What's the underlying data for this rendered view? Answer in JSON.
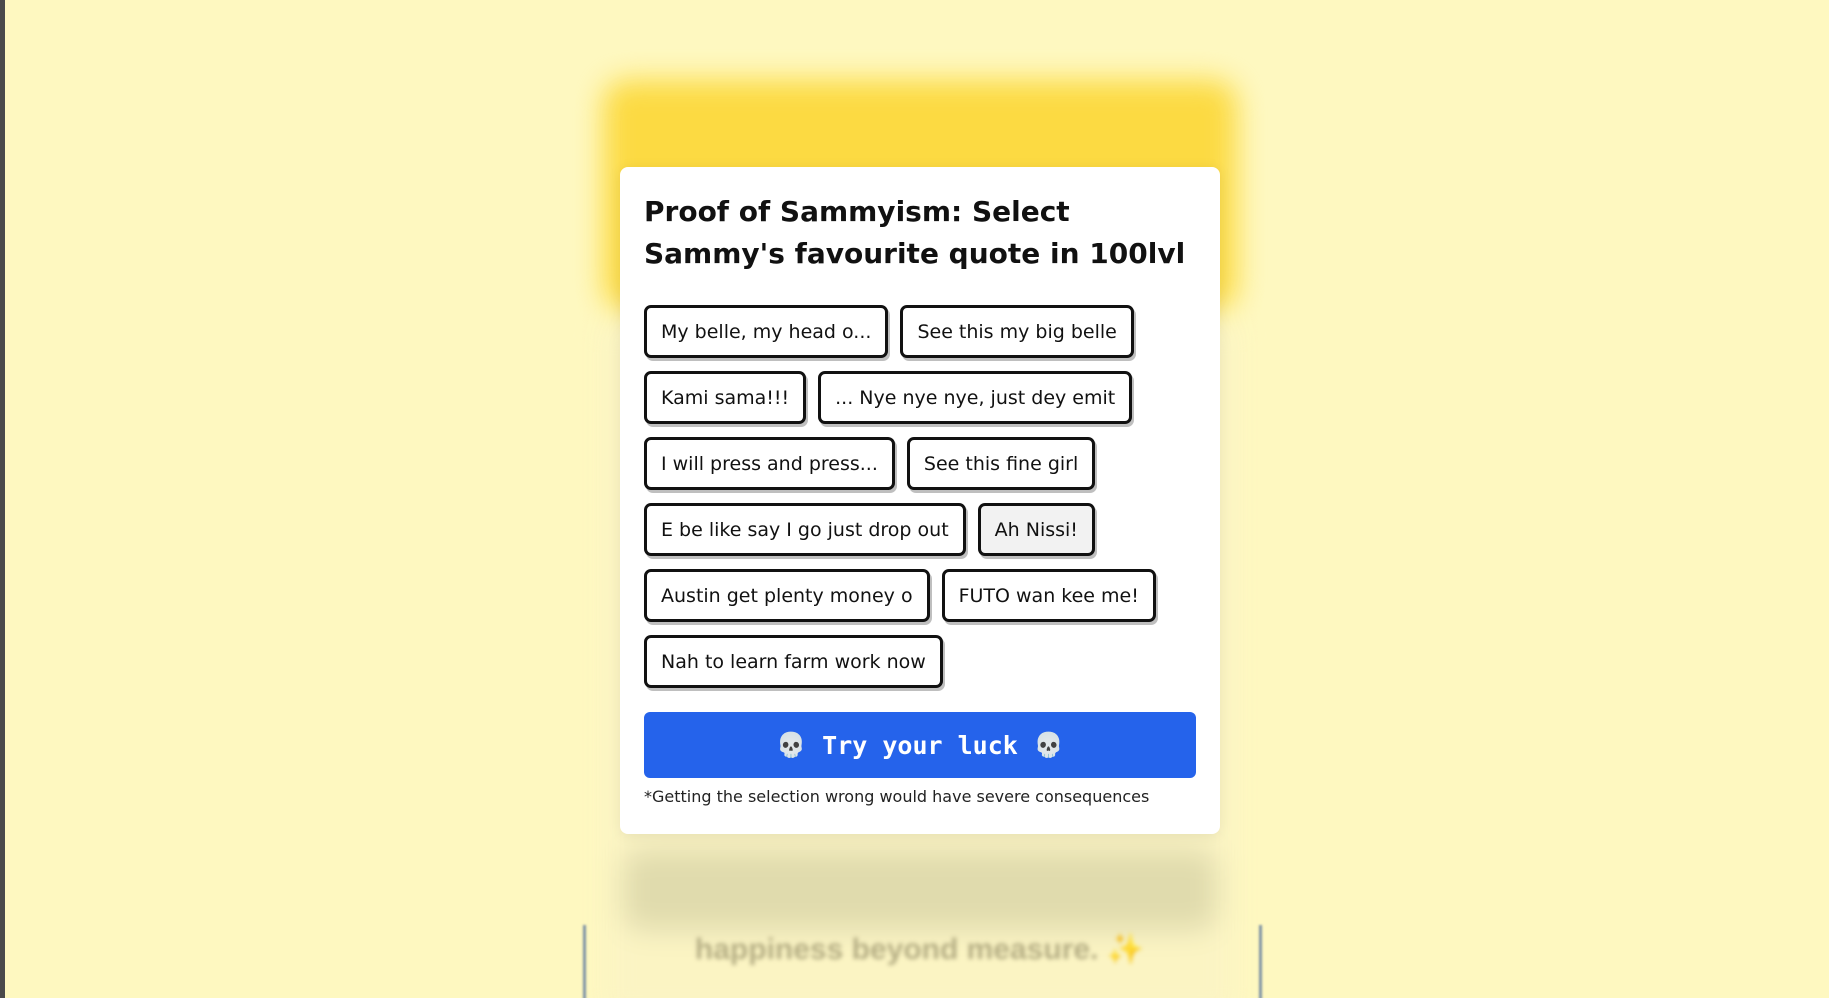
{
  "modal": {
    "title": "Proof of Sammyism: Select Sammy's favourite quote in 100lvl",
    "options": [
      {
        "label": "My belle, my head o...",
        "selected": false
      },
      {
        "label": "See this my big belle",
        "selected": false
      },
      {
        "label": "Kami sama!!!",
        "selected": false
      },
      {
        "label": "... Nye nye nye, just dey emit",
        "selected": false
      },
      {
        "label": "I will press and press...",
        "selected": false
      },
      {
        "label": "See this fine girl",
        "selected": false
      },
      {
        "label": "E be like say I go just drop out",
        "selected": false
      },
      {
        "label": "Ah Nissi!",
        "selected": true
      },
      {
        "label": "Austin get plenty money o",
        "selected": false
      },
      {
        "label": "FUTO wan kee me!",
        "selected": false
      },
      {
        "label": "Nah to learn farm work now",
        "selected": false
      }
    ],
    "submit_label": "Try your luck",
    "submit_icon": "skull-icon",
    "note": "*Getting the selection wrong would have severe consequences"
  },
  "background": {
    "caption": "happiness beyond measure. ✨"
  },
  "colors": {
    "page_background": "#fef8c0",
    "header_yellow": "#fcd93c",
    "button_blue": "#2563eb"
  }
}
